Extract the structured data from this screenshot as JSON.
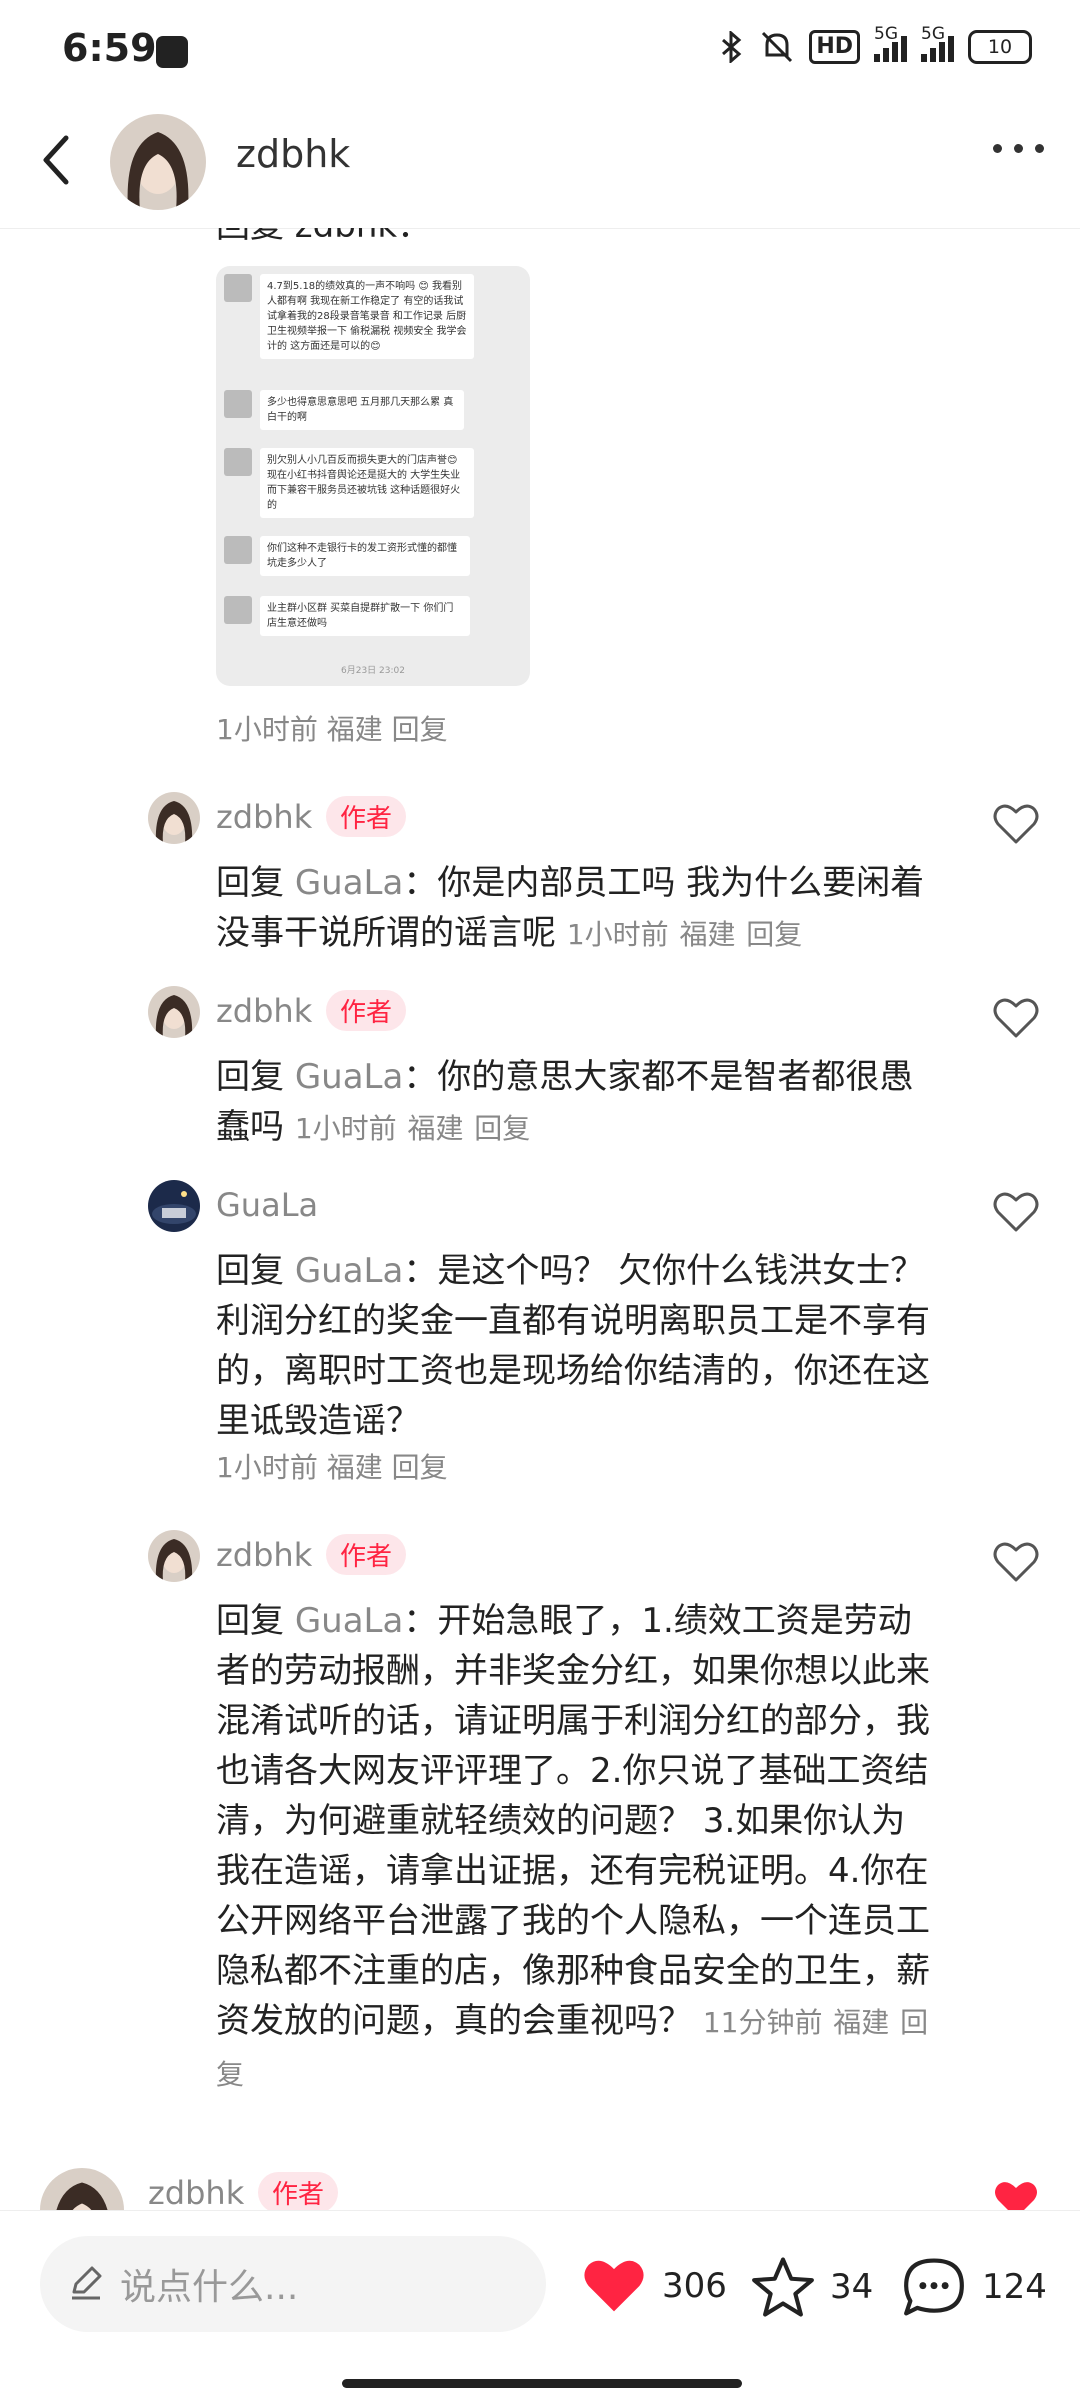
{
  "status_bar": {
    "time": "6:59",
    "network": "5G",
    "hd": "HD",
    "battery": "10"
  },
  "header": {
    "username": "zdbhk"
  },
  "screenshot_comment": {
    "partial_reply_text": "回复  zdbhk：",
    "image_messages": [
      "4.7到5.18的绩效真的一声不响吗 😊 我看别人都有啊 我现在新工作稳定了 有空的话我试试拿着我的28段录音笔录音 和工作记录 后厨卫生视频举报一下 偷税漏税 视频安全 我学会计的 这方面还是可以的😊",
      "多少也得意思意思吧 五月那几天那么累 真白干的啊",
      "别欠别人小几百反而损失更大的门店声誉😊 现在小红书抖音舆论还是挺大的 大学生失业而下兼容干服务员还被坑钱 这种话题很好火的",
      "你们这种不走银行卡的发工资形式懂的都懂 坑走多少人了",
      "业主群小区群 买菜自提群扩散一下 你们门店生意还做吗"
    ],
    "image_timestamp": "6月23日 23:02",
    "meta_time": "1小时前",
    "meta_location": "福建",
    "meta_reply": "回复"
  },
  "comments": [
    {
      "name": "zdbhk",
      "badge": "作者",
      "reply_prefix": "回复",
      "reply_to": "GuaLa",
      "text": "：你是内部员工吗 我为什么要闲着没事干说所谓的谣言呢",
      "time": "1小时前",
      "location": "福建",
      "reply": "回复"
    },
    {
      "name": "zdbhk",
      "badge": "作者",
      "reply_prefix": "回复",
      "reply_to": "GuaLa",
      "text": "：你的意思大家都不是智者都很愚蠢吗",
      "time": "1小时前",
      "location": "福建",
      "reply": "回复"
    },
    {
      "name": "GuaLa",
      "reply_prefix": "回复",
      "reply_to": "GuaLa",
      "text": "：是这个吗？ 欠你什么钱洪女士？ 利润分红的奖金一直都有说明离职员工是不享有的，离职时工资也是现场给你结清的，你还在这里诋毁造谣？",
      "time": "1小时前",
      "location": "福建",
      "reply": "回复"
    },
    {
      "name": "zdbhk",
      "badge": "作者",
      "reply_prefix": "回复",
      "reply_to": "GuaLa",
      "text": "：开始急眼了，1.绩效工资是劳动者的劳动报酬，并非奖金分红，如果你想以此来混淆试听的话，请证明属于利润分红的部分，我也请各大网友评评理了。2.你只说了基础工资结清，为何避重就轻绩效的问题？ 3.如果你认为我在造谣，请拿出证据，还有完税证明。4.你在公开网络平台泄露了我的个人隐私，一个连员工隐私都不注重的店，像那种食品安全的卫生，薪资发放的问题，真的会重视吗？",
      "time": "11分钟前",
      "location": "福建",
      "reply": "回复"
    },
    {
      "name": "zdbhk",
      "badge": "作者"
    }
  ],
  "bottom_bar": {
    "input_placeholder": "说点什么...",
    "likes": "306",
    "stars": "34",
    "comments": "124"
  },
  "colors": {
    "accent": "#ff2442",
    "badge_bg": "#fde6ea",
    "meta": "#888888"
  }
}
